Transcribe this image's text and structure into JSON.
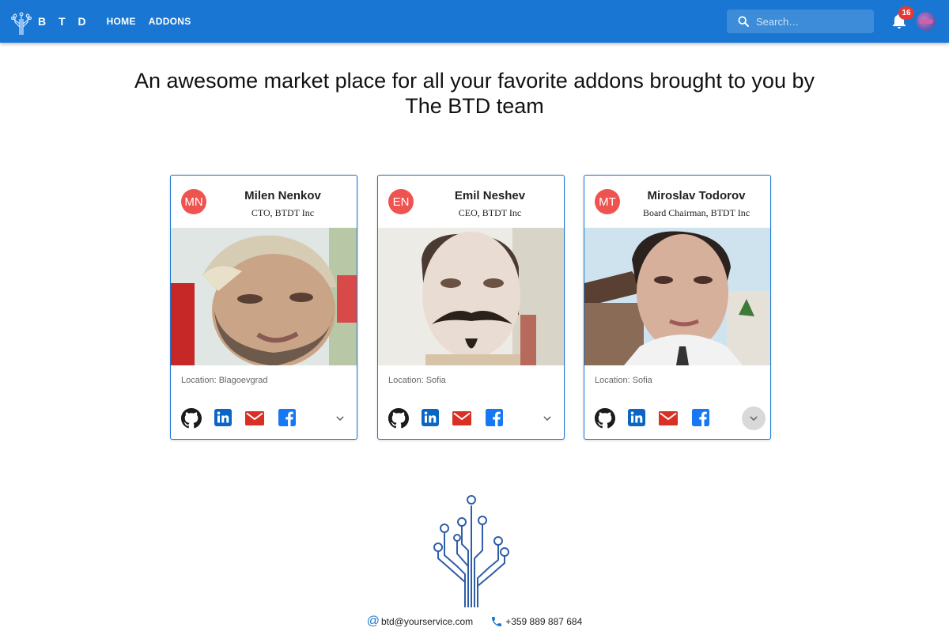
{
  "appbar": {
    "brand": "B T D",
    "nav": [
      "HOME",
      "ADDONS"
    ],
    "search_placeholder": "Search…",
    "notification_count": "16"
  },
  "headline": "An awesome market place for all your favorite addons brought to you by The BTD team",
  "team": [
    {
      "initials": "MN",
      "name": "Milen Nenkov",
      "role": "CTO, BTDT Inc",
      "location": "Location: Blagoevgrad"
    },
    {
      "initials": "EN",
      "name": "Emil Neshev",
      "role": "CEO, BTDT Inc",
      "location": "Location: Sofia"
    },
    {
      "initials": "MT",
      "name": "Miroslav Todorov",
      "role": "Board Chairman, BTDT Inc",
      "location": "Location: Sofia"
    }
  ],
  "social_icons": [
    "github-icon",
    "linkedin-icon",
    "email-icon",
    "facebook-icon"
  ],
  "footer": {
    "email": "btd@yourservice.com",
    "phone": "+359 889 887 684"
  },
  "colors": {
    "primary": "#1976d2",
    "avatar": "#ef5350",
    "gmail": "#d93025",
    "linkedin": "#0a66c2",
    "facebook": "#1877f2"
  }
}
